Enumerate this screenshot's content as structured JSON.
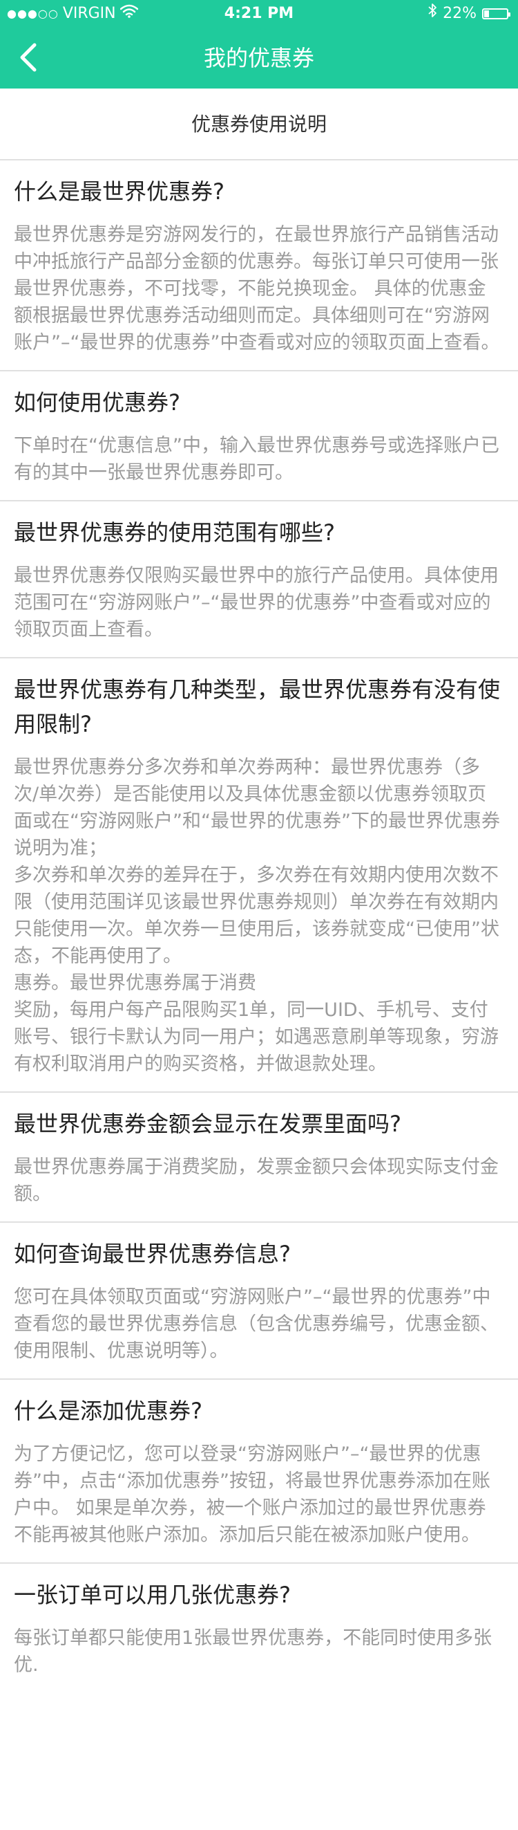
{
  "status_bar": {
    "signal": "●●●○○",
    "carrier": "VIRGIN",
    "wifi_icon": "wifi-icon",
    "time": "4:21 PM",
    "bluetooth_icon": "bluetooth-icon",
    "battery_percent": "22%",
    "battery_level": 0.22
  },
  "nav": {
    "back_icon": "chevron-left-icon",
    "title": "我的优惠券"
  },
  "subheader": {
    "title": "优惠券使用说明"
  },
  "colors": {
    "header_bg": "#1fcb9c",
    "question_text": "#222222",
    "answer_text": "#9a9a9a",
    "divider": "#e0e0e0"
  },
  "faq": [
    {
      "question": "什么是最世界优惠券?",
      "answer": "最世界优惠券是穷游网发行的，在最世界旅行产品销售活动中冲抵旅行产品部分金额的优惠券。每张订单只可使用一张最世界优惠券，不可找零，不能兑换现金。 具体的优惠金额根据最世界优惠券活动细则而定。具体细则可在“穷游网账户”–“最世界的优惠券”中查看或对应的领取页面上查看。"
    },
    {
      "question": "如何使用优惠券?",
      "answer": "下单时在“优惠信息”中，输入最世界优惠券号或选择账户已有的其中一张最世界优惠券即可。"
    },
    {
      "question": "最世界优惠券的使用范围有哪些?",
      "answer": "最世界优惠券仅限购买最世界中的旅行产品使用。具体使用范围可在“穷游网账户”–“最世界的优惠券”中查看或对应的领取页面上查看。"
    },
    {
      "question": "最世界优惠券有几种类型，最世界优惠券有没有使用限制?",
      "answer_lines": [
        "最世界优惠券分多次券和单次券两种：最世界优惠券（多次/单次券）是否能使用以及具体优惠金额以优惠券领取页面或在“穷游网账户”和“最世界的优惠券”下的最世界优惠券说明为准；",
        "多次券和单次券的差异在于，多次券在有效期内使用次数不限（使用范围详见该最世界优惠券规则）单次券在有效期内只能使用一次。单次券一旦使用后，该券就变成“已使用”状态，不能再使用了。",
        "惠券。最世界优惠券属于消费",
        "奖励，每用户每产品限购买1单，同一UID、手机号、支付账号、银行卡默认为同一用户；如遇恶意刷单等现象，穷游有权利取消用户的购买资格，并做退款处理。"
      ]
    },
    {
      "question": "最世界优惠券金额会显示在发票里面吗?",
      "answer": "最世界优惠券属于消费奖励，发票金额只会体现实际支付金额。"
    },
    {
      "question": "如何查询最世界优惠券信息?",
      "answer": "您可在具体领取页面或“穷游网账户”–“最世界的优惠券”中查看您的最世界优惠券信息（包含优惠券编号，优惠金额、使用限制、优惠说明等）。"
    },
    {
      "question": "什么是添加优惠券?",
      "answer": "为了方便记忆，您可以登录“穷游网账户”–“最世界的优惠券”中，点击“添加优惠券”按钮，将最世界优惠券添加在账户中。 如果是单次券，被一个账户添加过的最世界优惠券不能再被其他账户添加。添加后只能在被添加账户使用。"
    },
    {
      "question": "一张订单可以用几张优惠券?",
      "answer": "每张订单都只能使用1张最世界优惠券，不能同时使用多张优."
    }
  ]
}
